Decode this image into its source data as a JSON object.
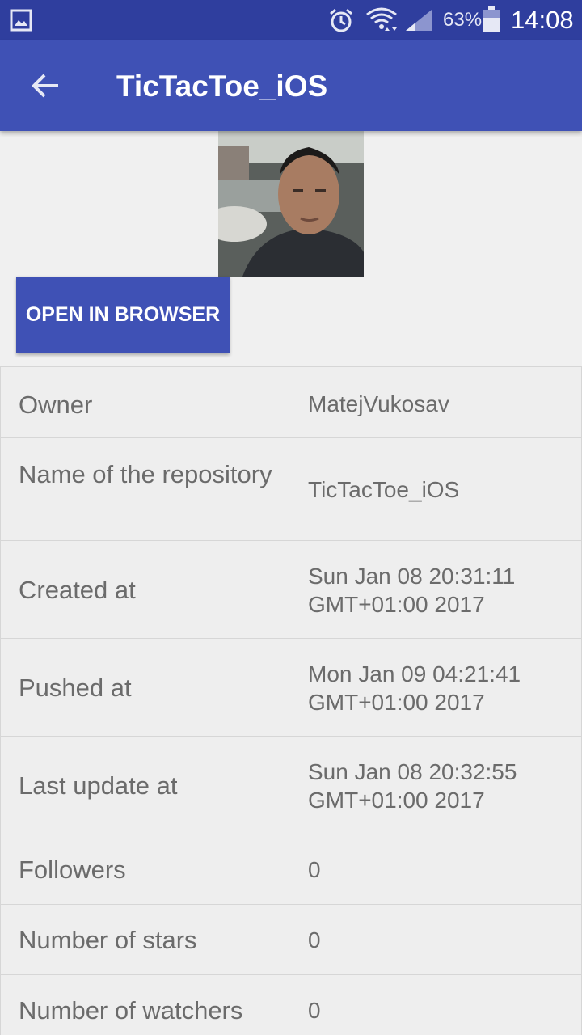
{
  "status_bar": {
    "battery_percent": "63%",
    "time": "14:08",
    "icons": [
      "gallery-icon",
      "alarm-icon",
      "wifi-icon",
      "signal-icon",
      "battery-icon"
    ]
  },
  "app_bar": {
    "title": "TicTacToe_iOS",
    "back_icon": "arrow-back-icon"
  },
  "avatar": {
    "description_icon": "user-avatar"
  },
  "actions": {
    "open_in_browser": "OPEN IN BROWSER"
  },
  "details": [
    {
      "label": "Owner",
      "value": "MatejVukosav"
    },
    {
      "label": "Name of the repository",
      "value": "TicTacToe_iOS"
    },
    {
      "label": "Created at",
      "value": "Sun Jan 08 20:31:11 GMT+01:00 2017"
    },
    {
      "label": "Pushed at",
      "value": "Mon Jan 09 04:21:41 GMT+01:00 2017"
    },
    {
      "label": "Last update at",
      "value": "Sun Jan 08 20:32:55 GMT+01:00 2017"
    },
    {
      "label": "Followers",
      "value": "0"
    },
    {
      "label": "Number of stars",
      "value": "0"
    },
    {
      "label": "Number of watchers",
      "value": "0"
    }
  ],
  "colors": {
    "primary": "#3f51b5",
    "primary_dark": "#2f3e9e",
    "background": "#f0f0f0",
    "text_secondary": "#6b6b6b"
  }
}
